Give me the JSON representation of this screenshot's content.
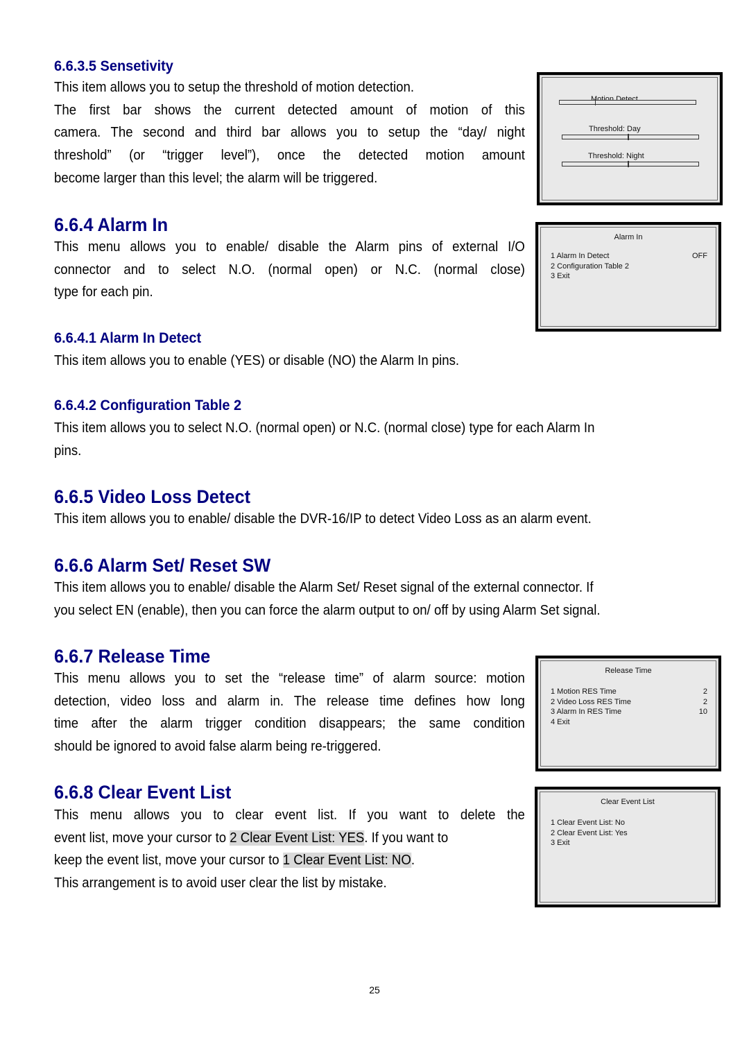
{
  "sections": {
    "sensitivity": {
      "heading": "6.6.3.5 Sensetivity",
      "lines": [
        "This item allows you to setup the threshold of motion detection.",
        "The first bar shows the current detected amount of motion of this",
        "camera. The second and third bar allows you to setup the “day/ night",
        "threshold” (or “trigger level”), once the detected motion amount",
        "become larger than this level; the alarm will be triggered."
      ]
    },
    "alarm_in": {
      "heading": "6.6.4 Alarm In",
      "lines": [
        "This menu allows you to enable/ disable the Alarm pins of external I/O",
        "connector and to select N.O. (normal open) or N.C. (normal close)",
        "type for each pin."
      ]
    },
    "alarm_in_detect": {
      "heading": "6.6.4.1 Alarm In Detect",
      "lines": [
        "This item allows you to enable (YES) or disable (NO) the Alarm In pins."
      ]
    },
    "config_table": {
      "heading": "6.6.4.2 Configuration Table 2",
      "lines": [
        "This item allows you to select N.O. (normal open) or N.C. (normal close) type for each Alarm In",
        "pins."
      ]
    },
    "video_loss": {
      "heading": "6.6.5 Video Loss Detect",
      "lines": [
        "This item allows you to enable/ disable the DVR-16/IP to detect Video Loss as an alarm event."
      ]
    },
    "alarm_set_reset": {
      "heading": "6.6.6 Alarm Set/ Reset SW",
      "lines": [
        "This item allows you to enable/ disable the Alarm Set/ Reset signal of the external connector. If",
        "you select EN (enable), then you can force the alarm output to on/ off by using Alarm Set signal."
      ]
    },
    "release_time": {
      "heading": "6.6.7 Release Time",
      "lines": [
        "This menu allows you to set the “release time” of alarm source: motion",
        "detection, video loss and alarm in. The release time defines how long",
        "time after the alarm trigger condition disappears; the same condition",
        "should be ignored to avoid false alarm being re-triggered."
      ]
    },
    "clear_event_list": {
      "heading": "6.6.8 Clear Event List",
      "line1": "This menu allows you to clear event list. If you want to delete the",
      "line2_pre": "event list, move your cursor to ",
      "line2_hl": "2 Clear Event List: YES",
      "line2_post": ". If you want to",
      "line3_pre": "keep the event list, move your cursor to ",
      "line3_hl": "1 Clear Event List: NO",
      "line3_post": ".",
      "line4": "This arrangement is to avoid user clear the list by mistake."
    }
  },
  "osd_menus": {
    "sensitivity": {
      "bars": [
        {
          "label": "Motion Detect",
          "level": 0.26
        },
        {
          "label": "Threshold: Day",
          "level": 0.48
        },
        {
          "label": "Threshold: Night",
          "level": 0.48
        }
      ]
    },
    "alarm_in": {
      "title": "Alarm In",
      "items": [
        {
          "label": "1 Alarm In Detect",
          "value": "OFF"
        },
        {
          "label": "2 Configuration Table 2",
          "value": ""
        },
        {
          "label": "3 Exit",
          "value": ""
        }
      ]
    },
    "release_time": {
      "title": "Release Time",
      "items": [
        {
          "label": "1 Motion RES Time",
          "value": "2"
        },
        {
          "label": "2 Video Loss RES Time",
          "value": "2"
        },
        {
          "label": "3 Alarm In RES Time",
          "value": "10"
        },
        {
          "label": "4 Exit",
          "value": ""
        }
      ]
    },
    "clear_event_list": {
      "title": "Clear Event List",
      "items": [
        {
          "label": "1 Clear Event List: No",
          "value": ""
        },
        {
          "label": "2 Clear Event List: Yes",
          "value": ""
        },
        {
          "label": "3 Exit",
          "value": ""
        }
      ]
    }
  },
  "footer": {
    "page_number": "25"
  }
}
